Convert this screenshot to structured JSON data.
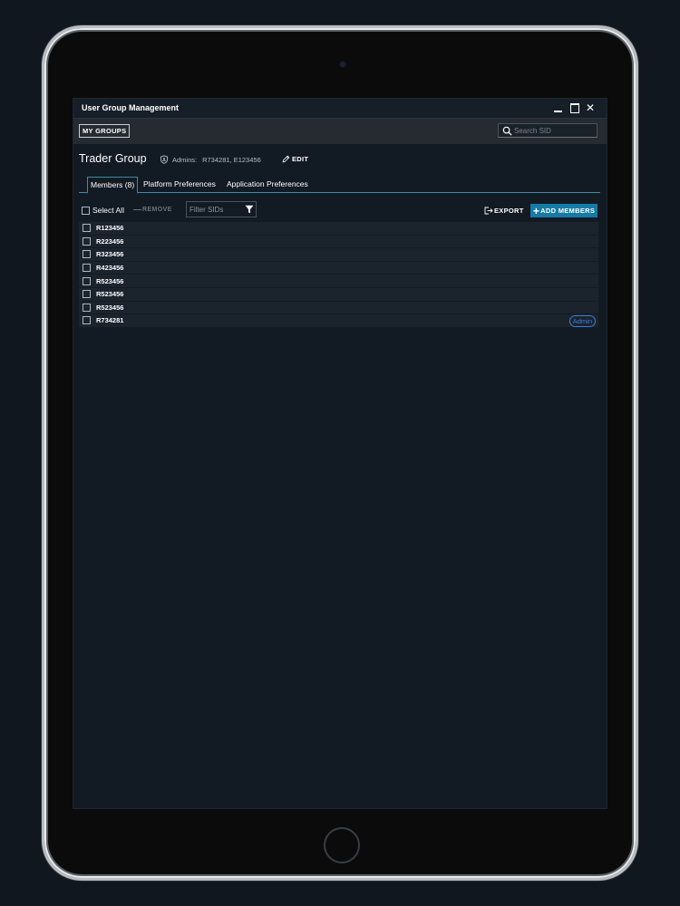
{
  "window": {
    "title": "User Group Management"
  },
  "toolbar": {
    "my_groups_label": "MY GROUPS",
    "search_placeholder": "Search SID"
  },
  "group": {
    "name": "Trader Group",
    "admins_label": "Admins:",
    "admins_value": "R734281, E123456",
    "edit_label": "EDIT"
  },
  "tabs": [
    {
      "label": "Members (8)",
      "active": true
    },
    {
      "label": "Platform Preferences",
      "active": false
    },
    {
      "label": "Application Preferences",
      "active": false
    }
  ],
  "list_tools": {
    "select_all_label": "Select All",
    "remove_label": "REMOVE",
    "filter_placeholder": "Filter SIDs",
    "export_label": "EXPORT",
    "add_members_label": "ADD MEMBERS"
  },
  "members": [
    {
      "sid": "R123456",
      "badge": ""
    },
    {
      "sid": "R223456",
      "badge": ""
    },
    {
      "sid": "R323456",
      "badge": ""
    },
    {
      "sid": "R423456",
      "badge": ""
    },
    {
      "sid": "R523456",
      "badge": ""
    },
    {
      "sid": "R523456",
      "badge": ""
    },
    {
      "sid": "R523456",
      "badge": ""
    },
    {
      "sid": "R734281",
      "badge": "Admin"
    }
  ],
  "colors": {
    "background": "#10171f",
    "window": "#121a23",
    "accent": "#167aa6",
    "tab_border": "#3e8aa6",
    "admin_badge": "#3b7fe0",
    "row": "#1b232d"
  },
  "icons": {
    "search": "search-icon",
    "shield": "shield-icon",
    "edit": "pencil-icon",
    "filter": "filter-icon",
    "export": "export-icon",
    "add": "plus-icon"
  }
}
